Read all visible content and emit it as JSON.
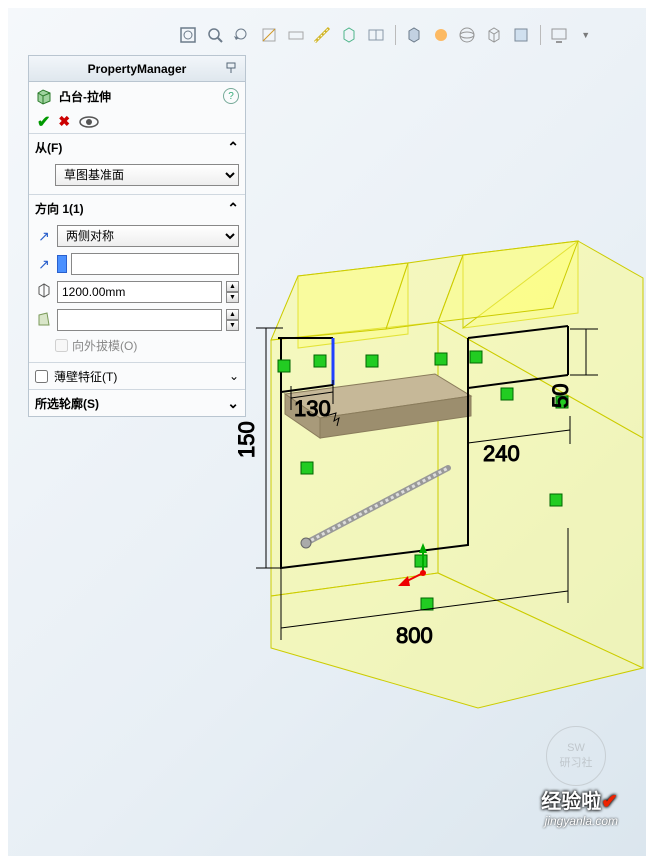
{
  "pm": {
    "title": "PropertyManager",
    "feature_title": "凸台-拉伸",
    "from": {
      "label": "从(F)",
      "value": "草图基准面"
    },
    "dir": {
      "label": "方向 1(1)",
      "end_condition": "两侧对称",
      "depth": "1200.00mm",
      "draft_label": "向外拔模(O)"
    },
    "thin": {
      "label": "薄壁特征(T)",
      "checked": false
    },
    "contours": {
      "label": "所选轮廓(S)"
    }
  },
  "dims": {
    "d130": "130",
    "d150": "150",
    "d240": "240",
    "d50": "50",
    "d800": "800"
  },
  "watermark": {
    "text": "经验啦",
    "url": "jingyanla.com"
  },
  "sw_badge": {
    "line1": "SW",
    "line2": "研习社"
  }
}
